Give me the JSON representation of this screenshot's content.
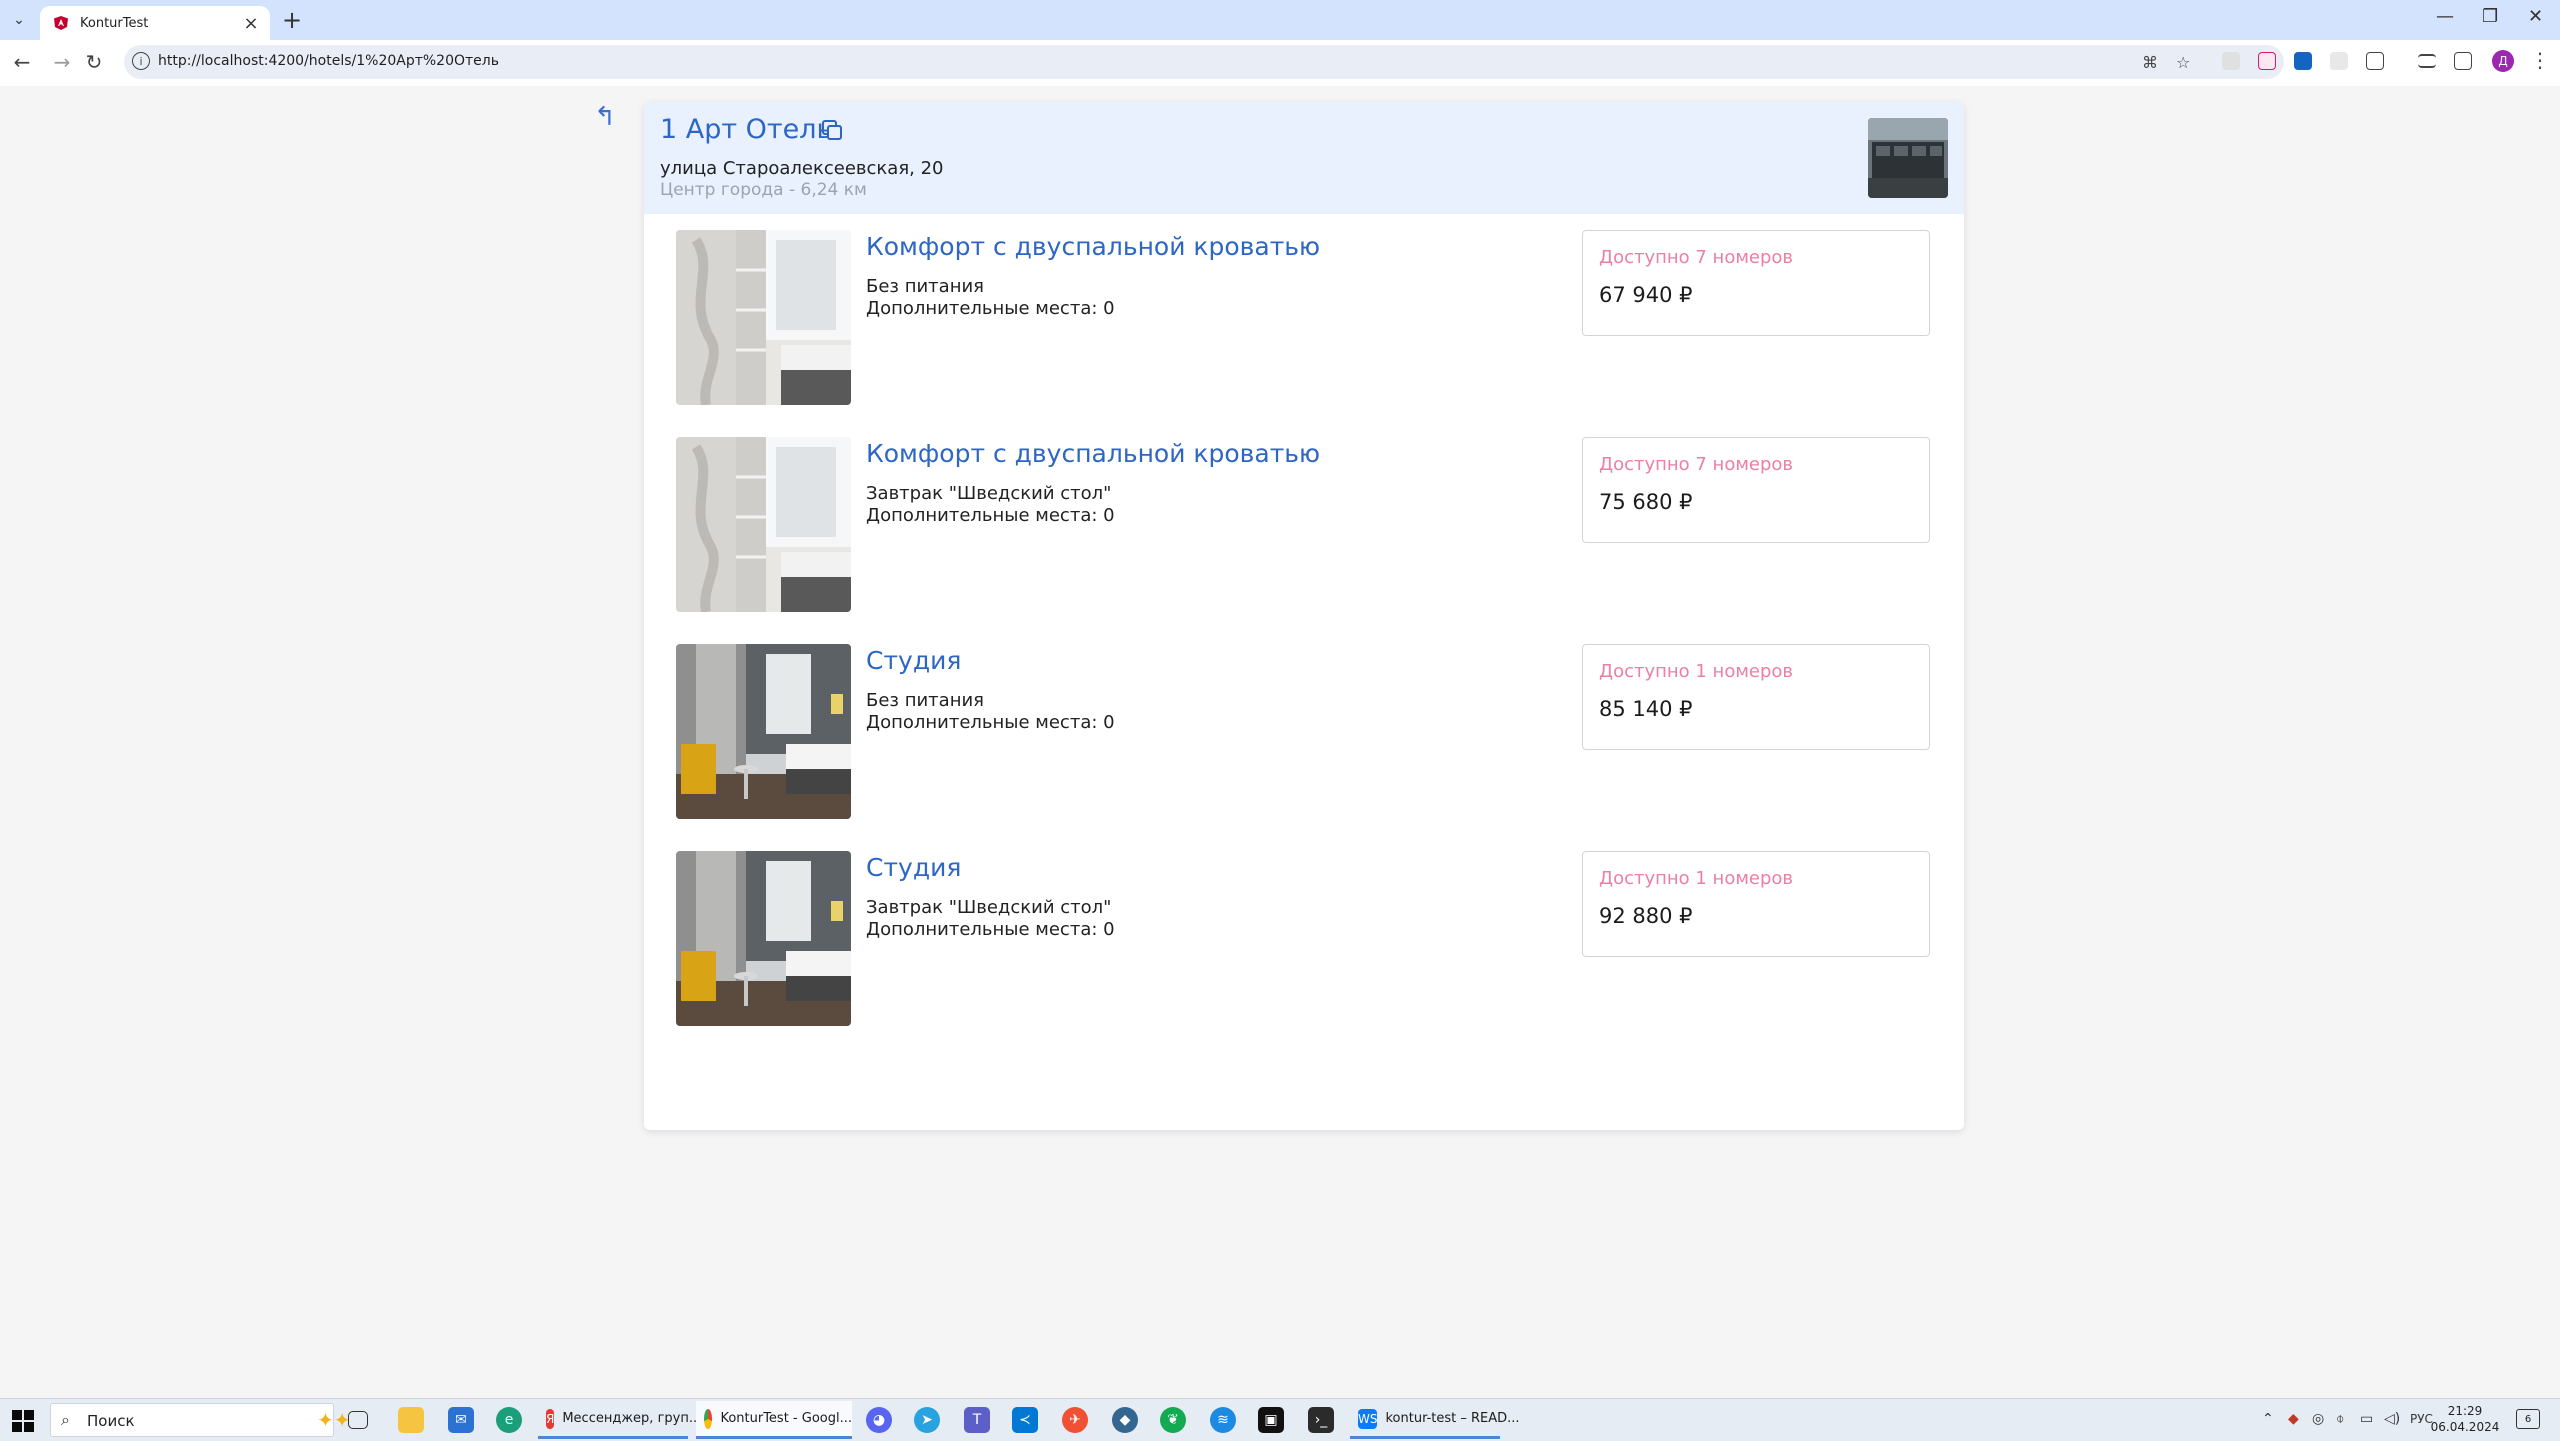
{
  "browser": {
    "tab_title": "KonturTest",
    "new_tab": "+",
    "url": "http://localhost:4200/hotels/1%20Арт%20Отель",
    "window_controls": {
      "minimize": "—",
      "restore": "❐",
      "close": "✕"
    }
  },
  "hotel": {
    "name": "1 Арт Отель",
    "address": "улица Староалексеевская, 20",
    "distance": "Центр города - 6,24 км"
  },
  "rooms": [
    {
      "name": "Комфорт с двуспальной кроватью",
      "meal": "Без питания",
      "extra": "Дополнительные места: 0",
      "availability": "Доступно 7 номеров",
      "price": "67 940 ₽",
      "photo": "comfort"
    },
    {
      "name": "Комфорт с двуспальной кроватью",
      "meal": "Завтрак \"Шведский стол\"",
      "extra": "Дополнительные места: 0",
      "availability": "Доступно 7 номеров",
      "price": "75 680 ₽",
      "photo": "comfort"
    },
    {
      "name": "Студия",
      "meal": "Без питания",
      "extra": "Дополнительные места: 0",
      "availability": "Доступно 1 номеров",
      "price": "85 140 ₽",
      "photo": "studio"
    },
    {
      "name": "Студия",
      "meal": "Завтрак \"Шведский стол\"",
      "extra": "Дополнительные места: 0",
      "availability": "Доступно 1 номеров",
      "price": "92 880 ₽",
      "photo": "studio"
    }
  ],
  "taskbar": {
    "search_placeholder": "Поиск",
    "apps": [
      {
        "label": "Мессенджер, груп...",
        "icon": "yandex-icon"
      },
      {
        "label": "KonturTest - Googl...",
        "icon": "chrome-icon"
      },
      {
        "label": "kontur-test – READ...",
        "icon": "webstorm-icon"
      }
    ],
    "language": "РУС",
    "time": "21:29",
    "date": "06.04.2024",
    "notifications": "6"
  },
  "colors": {
    "accent": "#2d66c5",
    "availability": "#ec7fa3",
    "header_bg": "#e8f1fd"
  }
}
